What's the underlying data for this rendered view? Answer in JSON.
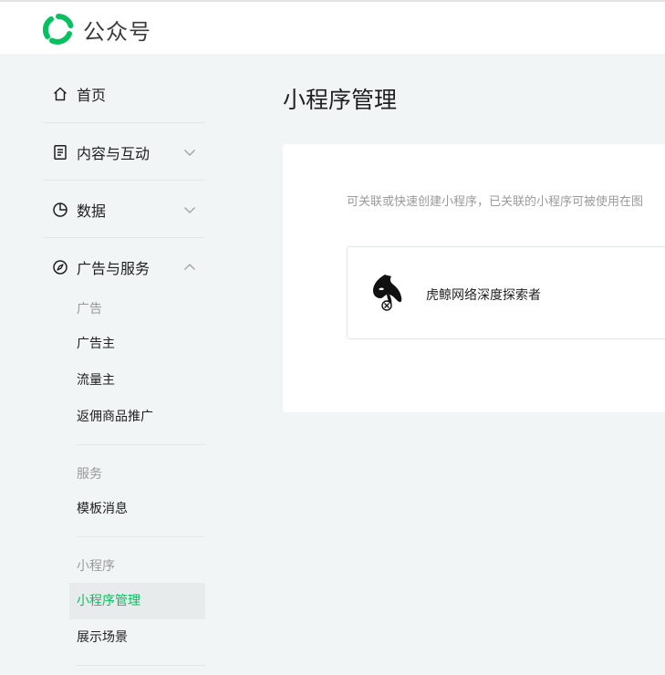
{
  "header": {
    "brand_name": "公众号",
    "logo_icon": "wechat-official-account-logo"
  },
  "sidebar": {
    "nav": [
      {
        "label": "首页",
        "icon": "home-icon"
      },
      {
        "label": "内容与互动",
        "icon": "document-icon",
        "expanded": false
      },
      {
        "label": "数据",
        "icon": "pie-chart-icon",
        "expanded": false
      },
      {
        "label": "广告与服务",
        "icon": "compass-icon",
        "expanded": true
      }
    ],
    "groups": {
      "ads": {
        "title": "广告",
        "items": [
          "广告主",
          "流量主",
          "返佣商品推广"
        ]
      },
      "services": {
        "title": "服务",
        "items": [
          "模板消息"
        ]
      },
      "miniprogram": {
        "title": "小程序",
        "items": [
          "小程序管理",
          "展示场景"
        ],
        "active": "小程序管理"
      }
    }
  },
  "main": {
    "title": "小程序管理",
    "description": "可关联或快速创建小程序，已关联的小程序可被使用在图",
    "miniprogram": {
      "name": "虎鲸网络深度探索者",
      "avatar_icon": "orca-avatar-icon"
    }
  },
  "colors": {
    "accent": "#07c160",
    "background": "#f2f5f6",
    "card": "#ffffff",
    "muted_text": "#9a9a9a"
  }
}
